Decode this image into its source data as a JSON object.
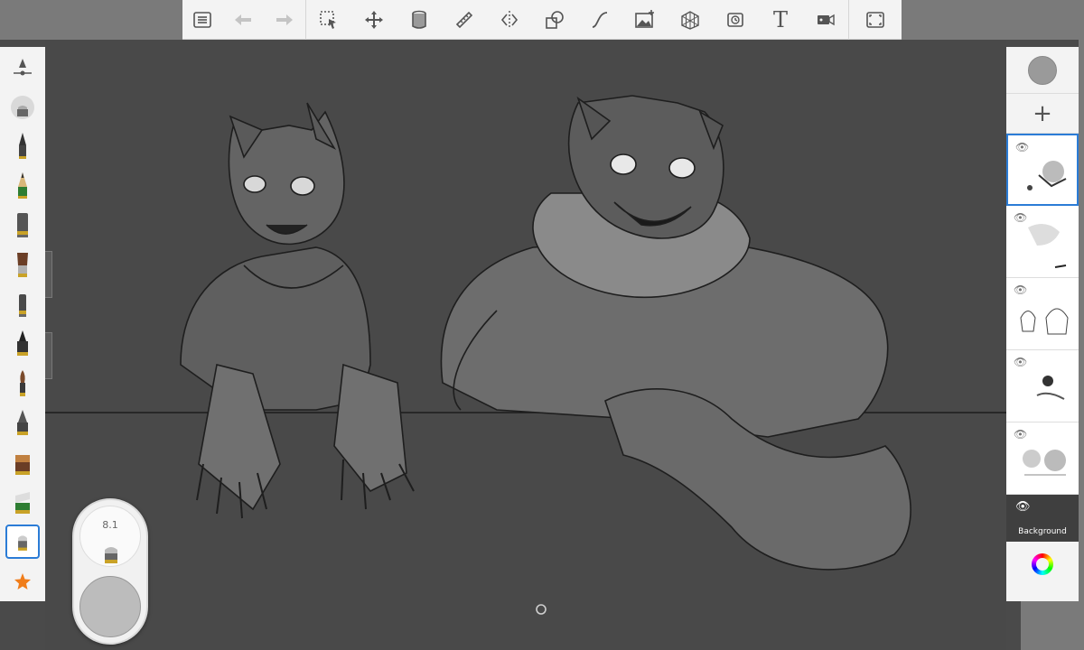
{
  "toolbar": {
    "items": [
      {
        "name": "layers-list-icon"
      },
      {
        "name": "undo-icon"
      },
      {
        "name": "redo-icon"
      },
      {
        "name": "selection-icon"
      },
      {
        "name": "transform-icon"
      },
      {
        "name": "fill-icon"
      },
      {
        "name": "ruler-icon"
      },
      {
        "name": "symmetry-icon"
      },
      {
        "name": "shapes-icon"
      },
      {
        "name": "curve-icon"
      },
      {
        "name": "image-icon"
      },
      {
        "name": "perspective-icon"
      },
      {
        "name": "time-lapse-icon"
      },
      {
        "name": "text-icon",
        "glyph": "T"
      },
      {
        "name": "record-icon"
      },
      {
        "name": "fullscreen-icon"
      }
    ]
  },
  "brush_panel": {
    "brushes": [
      "brush-properties",
      "soft-airbrush",
      "pencil",
      "sharp-pencil",
      "marker",
      "paint-brush",
      "ballpoint",
      "felt-pen",
      "flat-brush",
      "ink-pen",
      "smudge",
      "eraser-block",
      "eraser-soft",
      "selected-brush",
      "favorites-star"
    ]
  },
  "puck": {
    "size_value": "8.1"
  },
  "layers": {
    "items": [
      {
        "name": "layer-1",
        "active": true
      },
      {
        "name": "layer-2",
        "active": false
      },
      {
        "name": "layer-3",
        "active": false
      },
      {
        "name": "layer-4",
        "active": false
      },
      {
        "name": "layer-5",
        "active": false
      }
    ],
    "background_label": "Background",
    "add_symbol": "+"
  },
  "colors": {
    "accent": "#2b7cd6",
    "panel": "#f3f3f3",
    "canvas": "#494949",
    "current_color": "#9a9a9a"
  }
}
